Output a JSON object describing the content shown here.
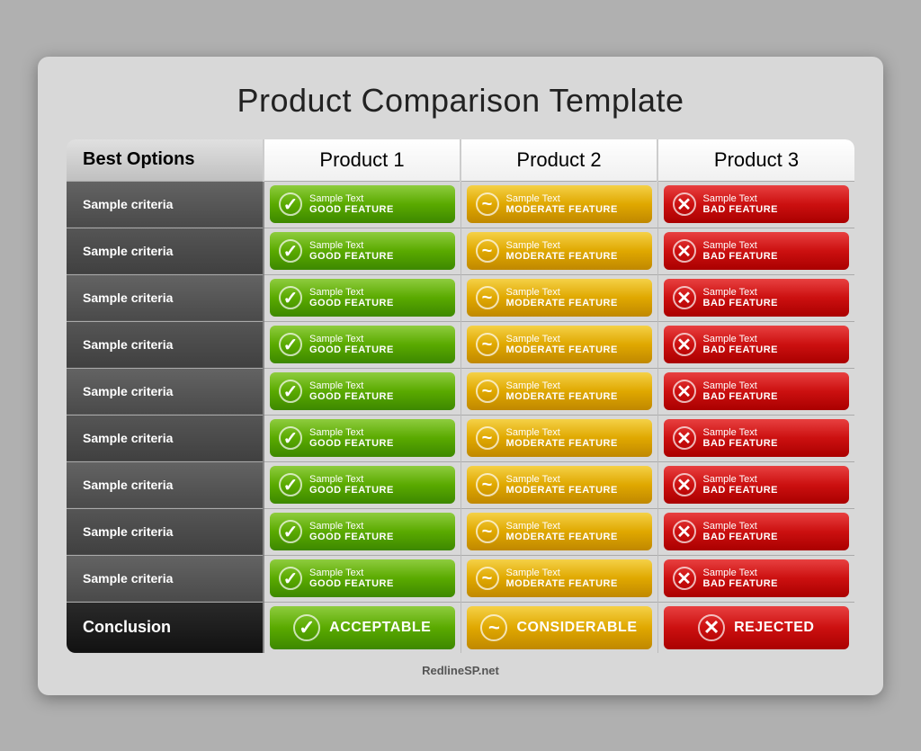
{
  "title": "Product Comparison Template",
  "header": {
    "col1": "Best Options",
    "col2": "Product 1",
    "col3": "Product 2",
    "col4": "Product 3"
  },
  "rows": [
    {
      "criteria": "Sample criteria"
    },
    {
      "criteria": "Sample criteria"
    },
    {
      "criteria": "Sample criteria"
    },
    {
      "criteria": "Sample criteria"
    },
    {
      "criteria": "Sample criteria"
    },
    {
      "criteria": "Sample criteria"
    },
    {
      "criteria": "Sample criteria"
    },
    {
      "criteria": "Sample criteria"
    },
    {
      "criteria": "Sample criteria"
    }
  ],
  "features": {
    "green": {
      "top": "Sample Text",
      "bottom": "GOOD FEATURE",
      "icon": "✓"
    },
    "yellow": {
      "top": "Sample Text",
      "bottom": "MODERATE FEATURE",
      "icon": "~"
    },
    "red": {
      "top": "Sample Text",
      "bottom": "BAD FEATURE",
      "icon": "✕"
    }
  },
  "conclusion": {
    "criteria": "Conclusion",
    "green": "ACCEPTABLE",
    "yellow": "CONSIDERABLE",
    "red": "REJECTED"
  },
  "footer": "RedlineSP.net"
}
